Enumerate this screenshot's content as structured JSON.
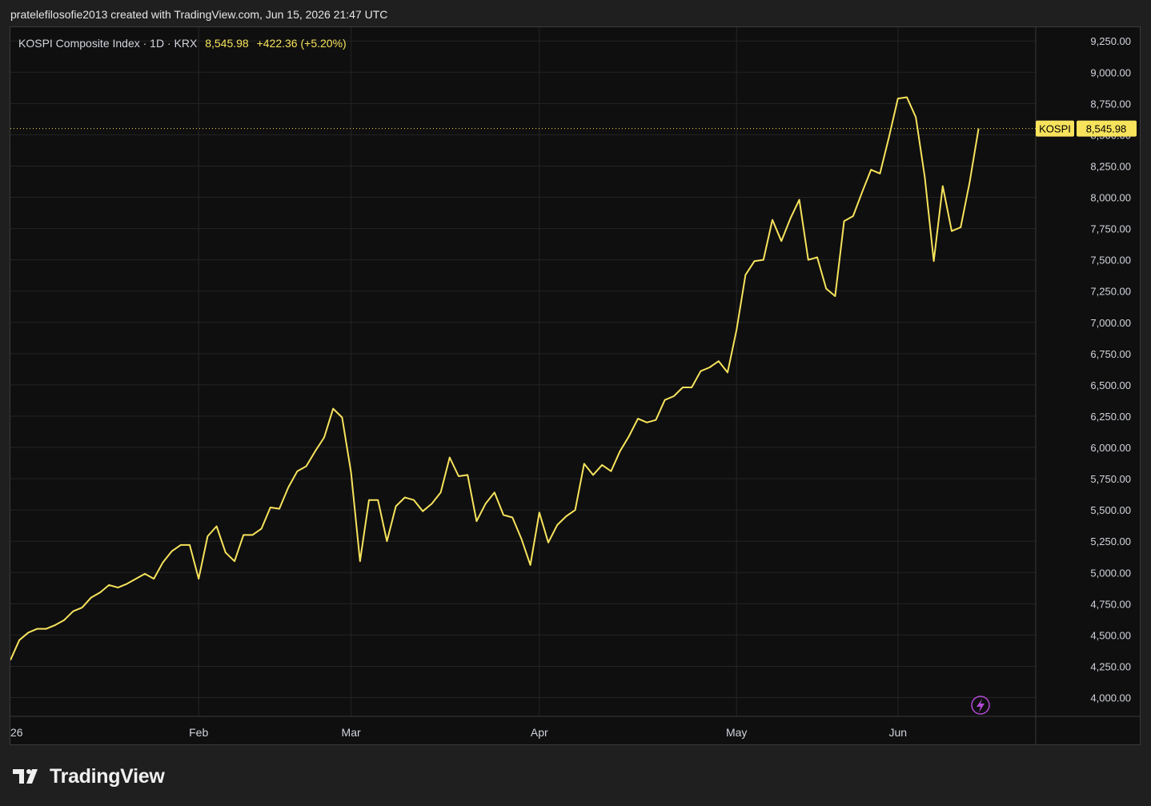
{
  "snapshot": {
    "caption": "pratelefilosofie2013 created with TradingView.com, Jun 15, 2026 21:47 UTC"
  },
  "legend": {
    "symbol_line": "KOSPI Composite Index · 1D · KRX",
    "last_value": "8,545.98",
    "change": "+422.36 (+5.20%)"
  },
  "price_tag": {
    "symbol": "KOSPI",
    "value": "8,545.98"
  },
  "brand": {
    "name": "TradingView"
  },
  "colors": {
    "line": "#f7e35c",
    "background": "#0f0f0f",
    "grid": "#242424",
    "alert_icon": "#b24bd6"
  },
  "icons": [
    "tradingview-logo-icon",
    "lightning-alert-icon"
  ],
  "chart_data": {
    "type": "line",
    "title": "KOSPI Composite Index · 1D · KRX",
    "xlabel": "",
    "ylabel": "",
    "ylim": [
      3850,
      9360
    ],
    "grid": true,
    "y_ticks": [
      4000,
      4250,
      4500,
      4750,
      5000,
      5250,
      5500,
      5750,
      6000,
      6250,
      6500,
      6750,
      7000,
      7250,
      7500,
      7750,
      8000,
      8250,
      8500,
      8750,
      9000,
      9250
    ],
    "y_tick_labels": [
      "4,000.00",
      "4,250.00",
      "4,500.00",
      "4,750.00",
      "5,000.00",
      "5,250.00",
      "5,500.00",
      "5,750.00",
      "6,000.00",
      "6,250.00",
      "6,500.00",
      "6,750.00",
      "7,000.00",
      "7,250.00",
      "7,500.00",
      "7,750.00",
      "8,000.00",
      "8,250.00",
      "8,500.00",
      "8,750.00",
      "9,000.00",
      "9,250.00"
    ],
    "x_ticks": [
      {
        "label": "26",
        "index": 0
      },
      {
        "label": "Feb",
        "index": 21
      },
      {
        "label": "Mar",
        "index": 38
      },
      {
        "label": "Apr",
        "index": 59
      },
      {
        "label": "May",
        "index": 81
      },
      {
        "label": "Jun",
        "index": 99
      }
    ],
    "series": [
      {
        "values": [
          4300,
          4460,
          4520,
          4550,
          4550,
          4580,
          4620,
          4690,
          4720,
          4800,
          4840,
          4900,
          4880,
          4910,
          4950,
          4990,
          4950,
          5080,
          5170,
          5220,
          5220,
          4950,
          5290,
          5370,
          5160,
          5090,
          5300,
          5300,
          5350,
          5520,
          5510,
          5680,
          5810,
          5850,
          5970,
          6080,
          6310,
          6240,
          5800,
          5090,
          5580,
          5580,
          5250,
          5530,
          5600,
          5580,
          5490,
          5550,
          5640,
          5920,
          5770,
          5780,
          5410,
          5550,
          5640,
          5460,
          5440,
          5270,
          5060,
          5480,
          5240,
          5380,
          5450,
          5500,
          5870,
          5780,
          5860,
          5810,
          5970,
          6090,
          6230,
          6200,
          6220,
          6380,
          6410,
          6480,
          6480,
          6610,
          6640,
          6690,
          6600,
          6940,
          7380,
          7490,
          7500,
          7820,
          7650,
          7830,
          7980,
          7500,
          7520,
          7270,
          7210,
          7810,
          7850,
          8040,
          8220,
          8190,
          8480,
          8790,
          8800,
          8640,
          8160,
          7490,
          8090,
          7730,
          7760,
          8120,
          8550
        ]
      }
    ]
  }
}
